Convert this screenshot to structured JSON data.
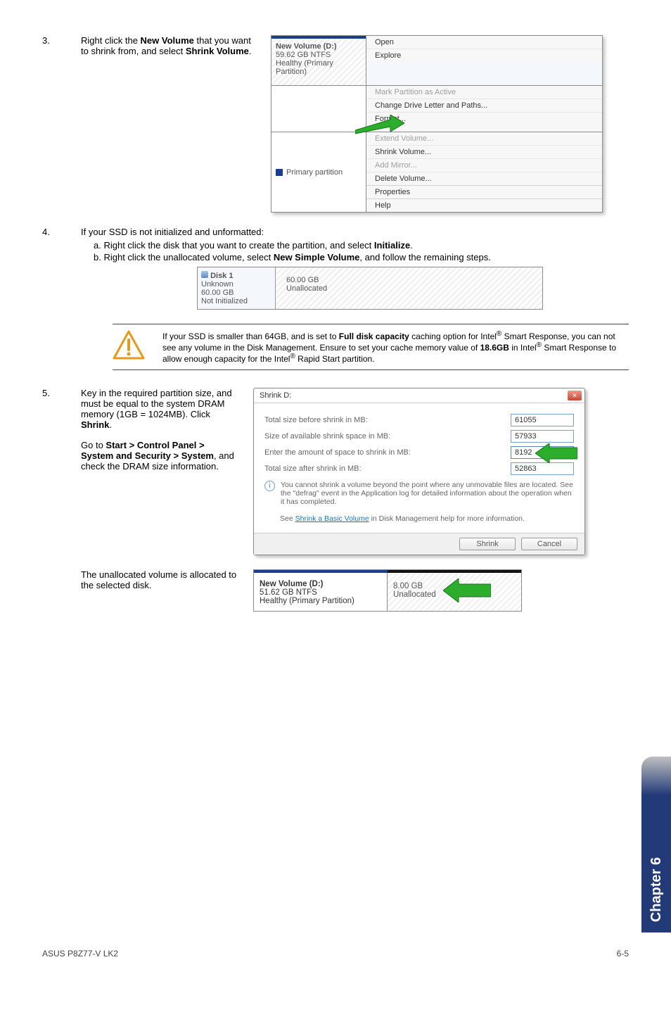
{
  "step3": {
    "num": "3.",
    "text_before": "Right click the ",
    "bold1": "New Volume",
    "text_mid": " that you want to shrink from, and select ",
    "bold2": "Shrink Volume",
    "text_after": "."
  },
  "dm1": {
    "vol_line1": "New Volume  (D:)",
    "vol_line2": "59.62 GB NTFS",
    "vol_line3": "Healthy (Primary Partition)",
    "primary_label": "Primary partition"
  },
  "ctx1": {
    "open": "Open",
    "explore": "Explore",
    "mark": "Mark Partition as Active",
    "change": "Change Drive Letter and Paths...",
    "format": "Format...",
    "extend": "Extend Volume...",
    "shrink": "Shrink Volume...",
    "addmirror": "Add Mirror...",
    "delete": "Delete Volume...",
    "properties": "Properties",
    "help": "Help"
  },
  "step4": {
    "num": "4.",
    "intro": "If your SSD is not initialized and unformatted:",
    "a_pref": "a.  ",
    "a_text1": "Right click the disk that you want to create the partition, and select ",
    "a_bold": "Initialize",
    "a_text2": ".",
    "b_pref": "b.  ",
    "b_text1": "Right click the unallocated volume, select ",
    "b_bold": "New Simple Volume",
    "b_text2": ", and follow the remaining steps."
  },
  "disk1": {
    "title": "Disk 1",
    "l2": "Unknown",
    "l3": "60.00 GB",
    "l4": "Not Initialized",
    "r1": "60.00 GB",
    "r2": "Unallocated"
  },
  "warning": {
    "t1": "If your SSD is smaller than 64GB, and is set to ",
    "b1": "Full disk capacity",
    "t2": " caching option for Intel",
    "t3": " Smart Response, you can not see any volume in the Disk Management. Ensure to set your cache memory value of ",
    "b2": "18.6GB",
    "t4": " in Intel",
    "t5": " Smart Response to allow enough capacity for the Intel",
    "t6": " Rapid Start partition."
  },
  "step5": {
    "num": "5.",
    "p1a": "Key in the required partition size, and must be equal to the system DRAM memory (1GB = 1024MB). Click ",
    "p1b": "Shrink",
    "p1c": ".",
    "p2a": "Go to ",
    "p2b": "Start > Control Panel > System and Security > System",
    "p2c": ", and check the DRAM size information."
  },
  "dlg": {
    "title": "Shrink D:",
    "f1": "Total size before shrink in MB:",
    "f1v": "61055",
    "f2": "Size of available shrink space in MB:",
    "f2v": "57933",
    "f3": "Enter the amount of space to shrink in MB:",
    "f3v": "8192",
    "f4": "Total size after shrink in MB:",
    "f4v": "52863",
    "info": "You cannot shrink a volume beyond the point where any unmovable files are located. See the \"defrag\" event in the Application log for detailed information about the operation when it has completed.",
    "see1": "See ",
    "see_link": "Shrink a Basic Volume",
    "see2": " in Disk Management help for more information.",
    "btn_shrink": "Shrink",
    "btn_cancel": "Cancel"
  },
  "step_alloc": "The unallocated volume is allocated to the selected disk.",
  "alloc": {
    "l1": "New Volume  (D:)",
    "l2": "51.62 GB NTFS",
    "l3": "Healthy (Primary Partition)",
    "r1": "8.00 GB",
    "r2": "Unallocated"
  },
  "sidetab": "Chapter 6",
  "footer_left": "ASUS P8Z77-V LK2",
  "footer_right": "6-5"
}
